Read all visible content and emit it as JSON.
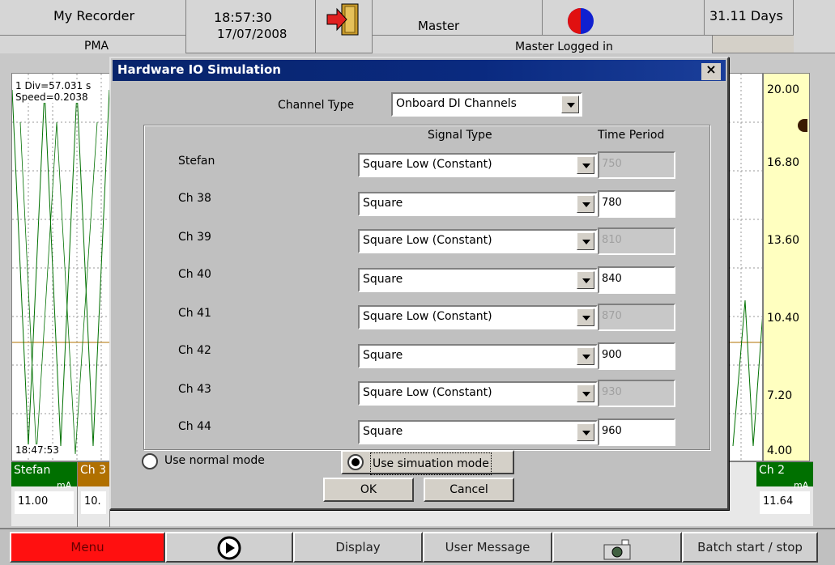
{
  "header": {
    "app_name": "My Recorder",
    "sub_name": "PMA",
    "time": "18:57:30",
    "date": "17/07/2008",
    "user": "Master",
    "status": "Master   Logged in",
    "days": "31.11 Days"
  },
  "chart": {
    "div_info": "1 Div=57.031 s",
    "speed_info": "Speed=0.2038",
    "time_marker": "18:47:53",
    "scale_ticks": [
      "20.00",
      "16.80",
      "13.60",
      "10.40",
      "7.20",
      "4.00"
    ]
  },
  "pens": [
    {
      "name": "Stefan",
      "unit": "mA",
      "value": "11.00",
      "color": "#007000"
    },
    {
      "name": "Ch 3",
      "unit": "",
      "value": "10.",
      "color": "#b07000"
    },
    {
      "name": "Ch 2",
      "unit": "mA",
      "value": "11.64",
      "color": "#007000"
    }
  ],
  "menu": {
    "menu": "Menu",
    "display": "Display",
    "user_message": "User Message",
    "batch": "Batch start / stop"
  },
  "dialog": {
    "title": "Hardware IO Simulation",
    "close": "×",
    "channel_type_label": "Channel Type",
    "channel_type_value": "Onboard DI Channels",
    "signal_type_header": "Signal Type",
    "time_period_header": "Time Period",
    "rows": [
      {
        "name": "Stefan",
        "signal": "Square Low (Constant)",
        "period": "750",
        "enabled": false
      },
      {
        "name": "Ch 38",
        "signal": "Square",
        "period": "780",
        "enabled": true
      },
      {
        "name": "Ch 39",
        "signal": "Square Low (Constant)",
        "period": "810",
        "enabled": false
      },
      {
        "name": "Ch 40",
        "signal": "Square",
        "period": "840",
        "enabled": true
      },
      {
        "name": "Ch 41",
        "signal": "Square Low (Constant)",
        "period": "870",
        "enabled": false
      },
      {
        "name": "Ch 42",
        "signal": "Square",
        "period": "900",
        "enabled": true
      },
      {
        "name": "Ch 43",
        "signal": "Square Low (Constant)",
        "period": "930",
        "enabled": false
      },
      {
        "name": "Ch 44",
        "signal": "Square",
        "period": "960",
        "enabled": true
      }
    ],
    "normal_mode": "Use normal mode",
    "sim_mode": "Use simuation mode",
    "ok": "OK",
    "cancel": "Cancel"
  }
}
